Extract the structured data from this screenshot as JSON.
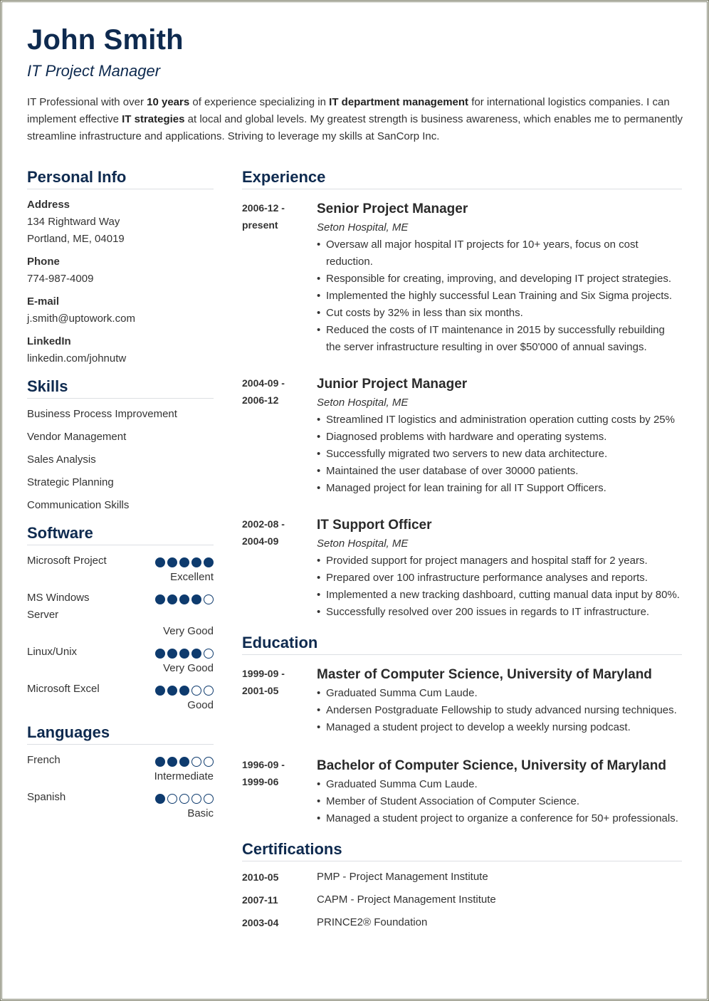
{
  "header": {
    "name": "John Smith",
    "role": "IT Project Manager",
    "summary": [
      {
        "t": "IT Professional with over ",
        "b": false
      },
      {
        "t": "10 years",
        "b": true
      },
      {
        "t": " of experience specializing in ",
        "b": false
      },
      {
        "t": "IT department management",
        "b": true
      },
      {
        "t": " for international logistics companies. I can implement effective ",
        "b": false
      },
      {
        "t": "IT strategies",
        "b": true
      },
      {
        "t": " at local and global levels. My greatest strength is business awareness, which enables me to permanently streamline infrastructure and applications. Striving to leverage my skills at SanCorp Inc.",
        "b": false
      }
    ]
  },
  "personal_info": {
    "title": "Personal Info",
    "items": [
      {
        "label": "Address",
        "lines": [
          "134 Rightward Way",
          "Portland, ME, 04019"
        ]
      },
      {
        "label": "Phone",
        "lines": [
          "774-987-4009"
        ]
      },
      {
        "label": "E-mail",
        "lines": [
          "j.smith@uptowork.com"
        ]
      },
      {
        "label": "LinkedIn",
        "lines": [
          "linkedin.com/johnutw"
        ]
      }
    ]
  },
  "skills": {
    "title": "Skills",
    "items": [
      "Business Process Improvement",
      "Vendor Management",
      "Sales Analysis",
      "Strategic Planning",
      "Communication Skills"
    ]
  },
  "software": {
    "title": "Software",
    "items": [
      {
        "name": "Microsoft Project",
        "rating": 5,
        "max": 5,
        "level": "Excellent"
      },
      {
        "name": "MS Windows Server",
        "rating": 4,
        "max": 5,
        "level": "Very Good"
      },
      {
        "name": "Linux/Unix",
        "rating": 4,
        "max": 5,
        "level": "Very Good"
      },
      {
        "name": "Microsoft Excel",
        "rating": 3,
        "max": 5,
        "level": "Good"
      }
    ]
  },
  "languages": {
    "title": "Languages",
    "items": [
      {
        "name": "French",
        "rating": 3,
        "max": 5,
        "level": "Intermediate"
      },
      {
        "name": "Spanish",
        "rating": 1,
        "max": 5,
        "level": "Basic"
      }
    ]
  },
  "experience": {
    "title": "Experience",
    "items": [
      {
        "date": "2006-12 - present",
        "title": "Senior Project Manager",
        "org": "Seton Hospital, ME",
        "bullets": [
          "Oversaw all major hospital IT projects for 10+ years, focus on cost reduction.",
          "Responsible for creating, improving, and developing IT project strategies.",
          "Implemented the highly successful Lean Training and Six Sigma projects.",
          "Cut costs by 32% in less than six months.",
          "Reduced the costs of IT maintenance in 2015 by successfully rebuilding the server infrastructure resulting in over $50'000 of annual savings."
        ]
      },
      {
        "date": "2004-09 - 2006-12",
        "title": "Junior Project Manager",
        "org": "Seton Hospital, ME",
        "bullets": [
          "Streamlined IT logistics and administration operation cutting costs by 25%",
          "Diagnosed problems with hardware and operating systems.",
          "Successfully migrated two servers to new data architecture.",
          "Maintained the user database of over 30000 patients.",
          "Managed project for lean training for all IT Support Officers."
        ]
      },
      {
        "date": "2002-08 - 2004-09",
        "title": "IT Support Officer",
        "org": "Seton Hospital, ME",
        "bullets": [
          "Provided support for project managers and hospital staff for 2 years.",
          "Prepared over 100 infrastructure performance analyses and reports.",
          "Implemented a new tracking dashboard, cutting manual data input by 80%.",
          "Successfully resolved over 200 issues in regards to IT infrastructure."
        ]
      }
    ]
  },
  "education": {
    "title": "Education",
    "items": [
      {
        "date": "1999-09 - 2001-05",
        "title": "Master of Computer Science, University of Maryland",
        "bullets": [
          "Graduated Summa Cum Laude.",
          "Andersen Postgraduate Fellowship to study advanced nursing techniques.",
          "Managed a student project to develop a weekly nursing podcast."
        ]
      },
      {
        "date": "1996-09 - 1999-06",
        "title": "Bachelor of Computer Science, University of Maryland",
        "bullets": [
          "Graduated Summa Cum Laude.",
          "Member of Student Association of Computer Science.",
          "Managed a student project to organize a conference for 50+ professionals."
        ]
      }
    ]
  },
  "certifications": {
    "title": "Certifications",
    "items": [
      {
        "date": "2010-05",
        "name": "PMP - Project Management Institute"
      },
      {
        "date": "2007-11",
        "name": "CAPM - Project Management Institute"
      },
      {
        "date": "2003-04",
        "name": "PRINCE2® Foundation"
      }
    ]
  },
  "colors": {
    "accent": "#0e2a4f",
    "dot_fill": "#0e3b6e",
    "text": "#333333",
    "frame": "#7b7d68"
  }
}
